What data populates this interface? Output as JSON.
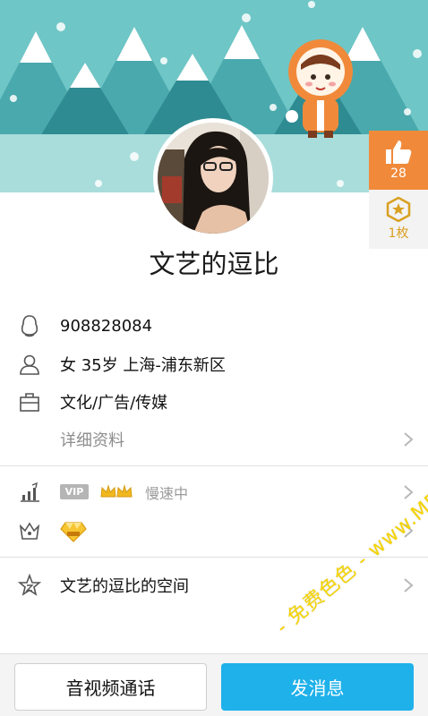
{
  "profile": {
    "nickname": "文艺的逗比",
    "qq_number": "908828084",
    "basic_info": "女  35岁  上海-浦东新区",
    "occupation": "文化/广告/传媒",
    "detail_link": "详细资料",
    "vip_tag": "VIP",
    "vip_status": "慢速中",
    "space_link": "文艺的逗比的空间"
  },
  "badges": {
    "likes": "28",
    "medals": "1枚"
  },
  "buttons": {
    "call": "音视频通话",
    "message": "发消息"
  },
  "watermark": "- 免费色色 - www.MFsese.com",
  "colors": {
    "banner_bg": "#6fc6c6",
    "like_bg": "#f08a3a",
    "primary_button": "#1fb1ea",
    "medal_gold": "#d9a021"
  },
  "icons": {
    "qq": "penguin-icon",
    "person": "person-icon",
    "work": "briefcase-icon",
    "level": "level-chart-icon",
    "crown": "crown-icon",
    "space": "star-icon"
  }
}
